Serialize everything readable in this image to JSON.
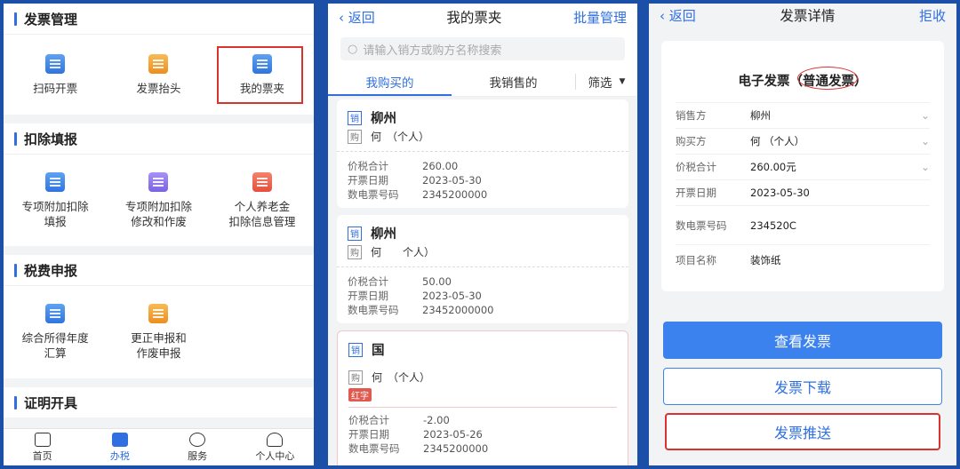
{
  "panel1": {
    "sections": [
      {
        "title": "发票管理",
        "items": [
          {
            "label": "扫码开票",
            "icon": "scan-invoice-icon"
          },
          {
            "label": "发票抬头",
            "icon": "invoice-header-icon"
          },
          {
            "label": "我的票夹",
            "icon": "invoice-wallet-icon"
          }
        ]
      },
      {
        "title": "扣除填报",
        "items": [
          {
            "label": "专项附加扣除\n填报",
            "icon": "deduction-fill-icon"
          },
          {
            "label": "专项附加扣除\n修改和作废",
            "icon": "deduction-modify-icon"
          },
          {
            "label": "个人养老金\n扣除信息管理",
            "icon": "pension-icon"
          }
        ]
      },
      {
        "title": "税费申报",
        "items": [
          {
            "label": "综合所得年度\n汇算",
            "icon": "annual-settlement-icon"
          },
          {
            "label": "更正申报和\n作废申报",
            "icon": "correction-icon"
          }
        ]
      },
      {
        "title": "证明开具"
      }
    ],
    "tabbar": [
      {
        "label": "首页"
      },
      {
        "label": "办税"
      },
      {
        "label": "服务"
      },
      {
        "label": "个人中心"
      }
    ]
  },
  "panel2": {
    "back": "返回",
    "title": "我的票夹",
    "right": "批量管理",
    "search_placeholder": "请输入销方或购方名称搜索",
    "tabs": [
      "我购买的",
      "我销售的",
      "筛选"
    ],
    "cards": [
      {
        "seller_tag": "销",
        "seller": "柳州",
        "buyer_tag": "购",
        "buyer": "何　（个人）",
        "amount_label": "价税合计",
        "amount": "260.00",
        "date_label": "开票日期",
        "date": "2023-05-30",
        "no_label": "数电票号码",
        "no": "2345200000"
      },
      {
        "seller_tag": "销",
        "seller": "柳州",
        "buyer_tag": "购",
        "buyer": "何　　个人）",
        "amount_label": "价税合计",
        "amount": "50.00",
        "date_label": "开票日期",
        "date": "2023-05-30",
        "no_label": "数电票号码",
        "no": "23452000000"
      },
      {
        "seller_tag": "销",
        "seller": "国",
        "buyer_tag": "购",
        "buyer": "何　（个人）",
        "red": "红字",
        "amount_label": "价税合计",
        "amount": "-2.00",
        "date_label": "开票日期",
        "date": "2023-05-26",
        "no_label": "数电票号码",
        "no": "2345200000"
      }
    ]
  },
  "panel3": {
    "back": "返回",
    "title": "发票详情",
    "right": "拒收",
    "doc_title": "电子发票（普通发票）",
    "rows": [
      {
        "k": "销售方",
        "v": "柳州",
        "chev": true
      },
      {
        "k": "购买方",
        "v": "何 （个人）",
        "chev": true
      },
      {
        "k": "价税合计",
        "v": "260.00元",
        "chev": true
      },
      {
        "k": "开票日期",
        "v": "2023-05-30",
        "chev": false
      },
      {
        "k": "数电票号码",
        "v": "234520C",
        "chev": false
      },
      {
        "k": "项目名称",
        "v": "装饰纸",
        "chev": false
      }
    ],
    "buttons": {
      "view": "查看发票",
      "download": "发票下载",
      "push": "发票推送"
    }
  }
}
